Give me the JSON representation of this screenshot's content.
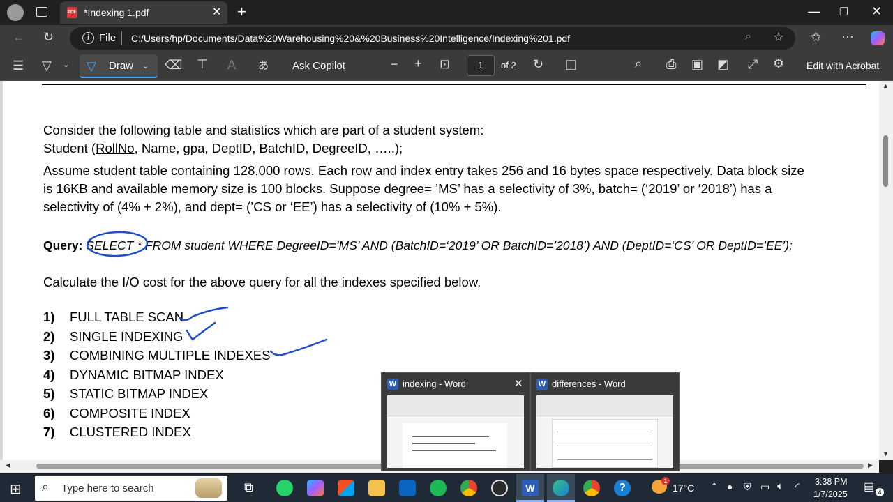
{
  "browser": {
    "tab_title": "*Indexing 1.pdf",
    "address_label": "File",
    "url": "C:/Users/hp/Documents/Data%20Warehousing%20&%20Business%20Intelligence/Indexing%201.pdf"
  },
  "pdf_toolbar": {
    "draw_label": "Draw",
    "copilot_label": "Ask Copilot",
    "current_page": "1",
    "page_total": "of 2",
    "acrobat_label": "Edit with Acrobat"
  },
  "document": {
    "intro_line1": "Consider the following table and statistics which are part of a student system:",
    "schema_prefix": "Student (",
    "schema_key": "RollNo",
    "schema_rest": ", Name, gpa, DeptID, BatchID, DegreeID,  …..);",
    "assume_line1": "Assume student table containing 128,000 rows. Each row and index entry takes 256 and 16 bytes space respectively. Data block size",
    "assume_line2": "is 16KB and available memory size is 100 blocks. Suppose degree= ’MS’ has a selectivity of 3%, batch= (‘2019’ or ‘2018’) has a",
    "assume_line3": "selectivity of (4% + 2%), and dept= (’CS or ‘EE’) has a selectivity of (10% + 5%).",
    "query_label": "Query:",
    "query_select": "SELECT  *",
    "query_rest": " FROM student   WHERE  DegreeID=’MS’  AND  (BatchID=‘2019’ OR BatchID=’2018’) AND  (DeptID=‘CS’ OR DeptID=’EE’);",
    "calc_line": "Calculate the I/O cost for the above query for all the indexes specified below.",
    "items": [
      {
        "num": "1)",
        "label": "FULL TABLE SCAN"
      },
      {
        "num": "2)",
        "label": "SINGLE INDEXING"
      },
      {
        "num": "3)",
        "label": "COMBINING MULTIPLE INDEXES"
      },
      {
        "num": "4)",
        "label": "DYNAMIC BITMAP INDEX"
      },
      {
        "num": "5)",
        "label": "STATIC BITMAP INDEX"
      },
      {
        "num": "6)",
        "label": "COMPOSITE INDEX"
      },
      {
        "num": "7)",
        "label": "CLUSTERED INDEX"
      }
    ],
    "annotation_color": "#1f4fc4"
  },
  "previews": [
    {
      "title": "indexing - Word"
    },
    {
      "title": "differences - Word"
    }
  ],
  "taskbar": {
    "search_placeholder": "Type here to search",
    "temperature": "17°C",
    "weather_badge": "1",
    "time": "3:38 PM",
    "date": "1/7/2025",
    "notification_count": "4"
  }
}
